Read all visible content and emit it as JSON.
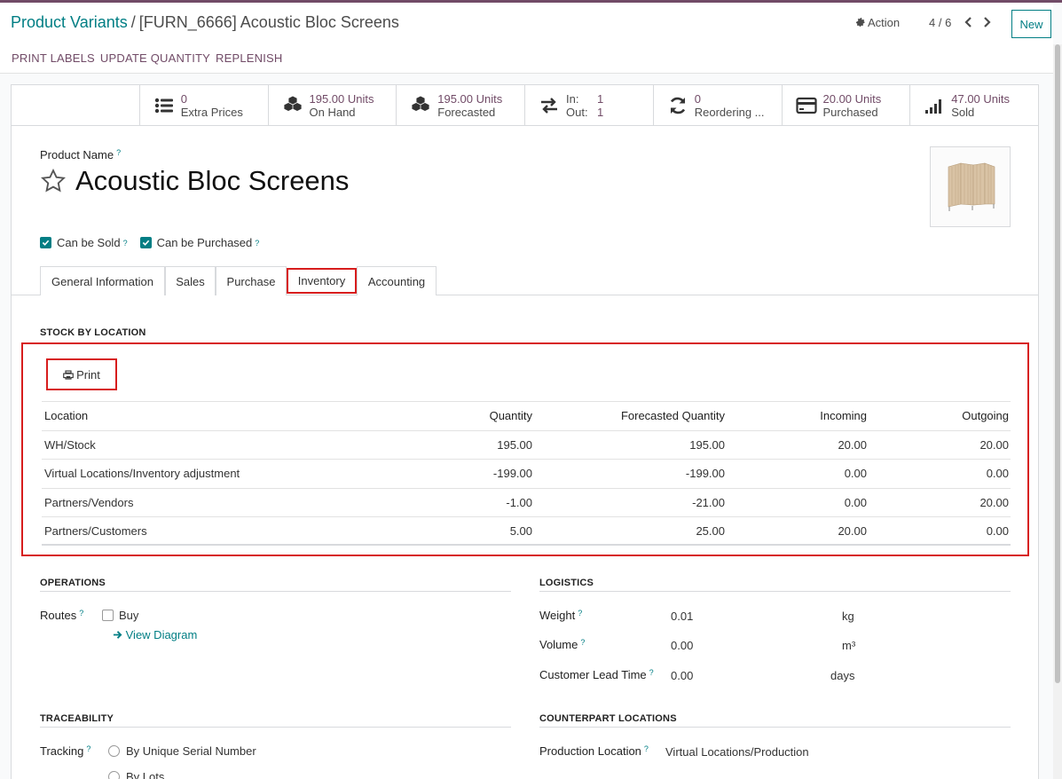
{
  "breadcrumb": {
    "parent": "Product Variants",
    "separator": "/",
    "current": "[FURN_6666] Acoustic Bloc Screens"
  },
  "header": {
    "action_label": "Action",
    "pager": "4 / 6",
    "new_label": "New"
  },
  "action_bar": {
    "print_labels": "PRINT LABELS",
    "update_quantity": "UPDATE QUANTITY",
    "replenish": "REPLENISH"
  },
  "stats": [
    {
      "icon": "list-icon",
      "value": "0",
      "label": "Extra Prices"
    },
    {
      "icon": "cubes-icon",
      "value": "195.00 Units",
      "label": "On Hand"
    },
    {
      "icon": "cubes-icon",
      "value": "195.00 Units",
      "label": "Forecasted"
    },
    {
      "icon": "exchange-icon",
      "in_label": "In:",
      "in_value": "1",
      "out_label": "Out:",
      "out_value": "1"
    },
    {
      "icon": "refresh-icon",
      "value": "0",
      "label": "Reordering ..."
    },
    {
      "icon": "credit-card-icon",
      "value": "20.00 Units",
      "label": "Purchased"
    },
    {
      "icon": "signal-icon",
      "value": "47.00 Units",
      "label": "Sold"
    }
  ],
  "product": {
    "name_label": "Product Name",
    "help_mark": "?",
    "name": "Acoustic Bloc Screens",
    "can_be_sold": "Can be Sold",
    "can_be_purchased": "Can be Purchased"
  },
  "tabs": [
    "General Information",
    "Sales",
    "Purchase",
    "Inventory",
    "Accounting"
  ],
  "active_tab": "Inventory",
  "stock": {
    "title": "STOCK BY LOCATION",
    "print_label": "Print",
    "columns": [
      "Location",
      "Quantity",
      "Forecasted Quantity",
      "Incoming",
      "Outgoing"
    ],
    "rows": [
      [
        "WH/Stock",
        "195.00",
        "195.00",
        "20.00",
        "20.00"
      ],
      [
        "Virtual Locations/Inventory adjustment",
        "-199.00",
        "-199.00",
        "0.00",
        "0.00"
      ],
      [
        "Partners/Vendors",
        "-1.00",
        "-21.00",
        "0.00",
        "20.00"
      ],
      [
        "Partners/Customers",
        "5.00",
        "25.00",
        "20.00",
        "0.00"
      ]
    ]
  },
  "operations": {
    "title": "OPERATIONS",
    "routes_label": "Routes",
    "buy_label": "Buy",
    "view_diagram": "View Diagram"
  },
  "logistics": {
    "title": "LOGISTICS",
    "weight_label": "Weight",
    "weight_value": "0.01",
    "weight_unit": "kg",
    "volume_label": "Volume",
    "volume_value": "0.00",
    "volume_unit": "m³",
    "lead_label": "Customer Lead Time",
    "lead_value": "0.00",
    "lead_unit": "days"
  },
  "traceability": {
    "title": "TRACEABILITY",
    "tracking_label": "Tracking",
    "option_serial": "By Unique Serial Number",
    "option_lots": "By Lots"
  },
  "counterpart": {
    "title": "COUNTERPART LOCATIONS",
    "production_label": "Production Location",
    "production_value": "Virtual Locations/Production"
  },
  "colors": {
    "brand": "#714b67",
    "accent": "#017e84",
    "highlight": "#d71d1d"
  }
}
